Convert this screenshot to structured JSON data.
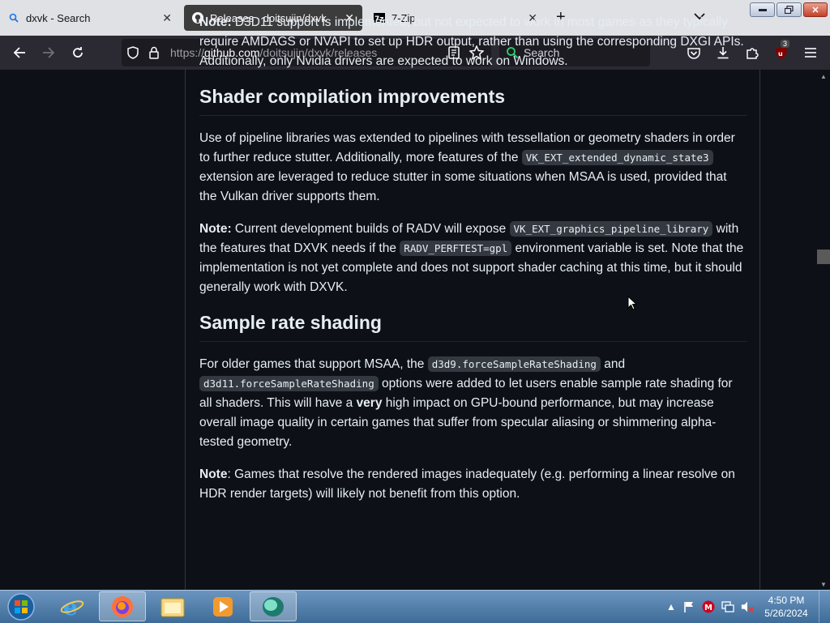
{
  "tabs": [
    {
      "title": "dxvk - Search",
      "icon": "search-icon",
      "active": false
    },
    {
      "title": "Releases · doitsujin/dxvk",
      "icon": "github-icon",
      "active": true
    },
    {
      "title": "7-Zip",
      "icon": "7zip-icon",
      "active": false
    }
  ],
  "toolbar": {
    "url_prefix": "https://",
    "url_host": "github.com",
    "url_path": "/doitsujin/dxvk/releases",
    "search_placeholder": "Search",
    "extension_badge": "3"
  },
  "content": {
    "note1": {
      "label": "Note:",
      "text": "D3D11 support is implemented, but not expected to work in most games as they typically require AMDAGS or NVAPI to set up HDR output, rather than using the corresponding DXGI APIs. Additionally, only Nvidia drivers are expected to work on Windows."
    },
    "section1": {
      "heading": "Shader compilation improvements",
      "p1_a": "Use of pipeline libraries was extended to pipelines with tessellation or geometry shaders in order to further reduce stutter. Additionally, more features of the",
      "p1_code": "VK_EXT_extended_dynamic_state3",
      "p1_b": "extension are leveraged to reduce stutter in some situations when MSAA is used, provided that the Vulkan driver supports them.",
      "note_label": "Note:",
      "note_a": "Current development builds of RADV will expose",
      "note_code1": "VK_EXT_graphics_pipeline_library",
      "note_b": "with the features that DXVK needs if the",
      "note_code2": "RADV_PERFTEST=gpl",
      "note_c": "environment variable is set. Note that the implementation is not yet complete and does not support shader caching at this time, but it should generally work with DXVK."
    },
    "section2": {
      "heading": "Sample rate shading",
      "p1_a": "For older games that support MSAA, the",
      "p1_code1": "d3d9.forceSampleRateShading",
      "p1_b": "and",
      "p1_code2": "d3d11.forceSampleRateShading",
      "p1_c": "options were added to let users enable sample rate shading for all shaders. This will have a",
      "p1_bold": "very",
      "p1_d": "high impact on GPU-bound performance, but may increase overall image quality in certain games that suffer from specular aliasing or shimmering alpha-tested geometry.",
      "note_label": "Note",
      "note_text": ": Games that resolve the rendered images inadequately (e.g. performing a linear resolve on HDR render targets) will likely not benefit from this option."
    }
  },
  "taskbar": {
    "apps": [
      "start-orb",
      "internet-explorer",
      "firefox",
      "windows-explorer",
      "media-player",
      "app"
    ],
    "time": "4:50 PM",
    "date": "5/26/2024"
  }
}
